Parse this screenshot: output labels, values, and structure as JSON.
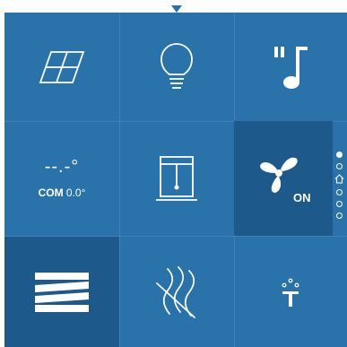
{
  "tiles": [
    {
      "name": "solar-panel",
      "icon": "solar-panel-icon"
    },
    {
      "name": "light",
      "icon": "light-bulb-icon"
    },
    {
      "name": "music",
      "icon": "music-note-icon"
    },
    {
      "name": "climate",
      "icon": "thermostat-icon",
      "placeholder": "--.-°",
      "label": "COM",
      "value": "0.0°"
    },
    {
      "name": "window",
      "icon": "window-blind-icon"
    },
    {
      "name": "fan",
      "icon": "fan-icon",
      "state": "ON",
      "active": true
    },
    {
      "name": "shading",
      "icon": "shading-icon",
      "active": true
    },
    {
      "name": "wind",
      "icon": "wind-icon"
    },
    {
      "name": "irrigation",
      "icon": "sprinkler-icon"
    }
  ],
  "pager": {
    "pages": 6,
    "current": 0,
    "home_icon": "home-icon"
  },
  "colors": {
    "panel": "#2a73aa",
    "active_tile": "#1d598a",
    "foreground": "#ffffff"
  }
}
